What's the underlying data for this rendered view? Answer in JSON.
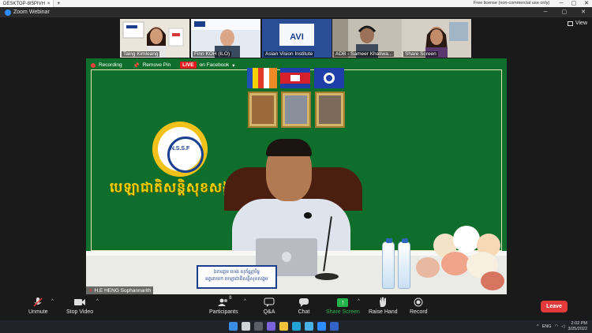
{
  "remote_bar": {
    "tab_title": "DESKTOP-8I5PIVH",
    "close": "×",
    "add": "+",
    "license": "Free license (non-commercial use only)",
    "controls": [
      "─",
      "▢",
      "✕"
    ]
  },
  "zoom_title": {
    "title": "Zoom Webinar",
    "controls": [
      "─",
      "▢",
      "✕"
    ]
  },
  "view_button": "View",
  "gallery": [
    {
      "name": "Taing Kimleang",
      "bg": "#e8e2d8",
      "person": "#5b3a2c"
    },
    {
      "name": "Finn KOH (ILO)",
      "bg": "#dfe6ef",
      "person": "#c89b7e"
    },
    {
      "name": "Asian Vision Institute",
      "bg": "#f2f4f8",
      "person": "#1b3f8a"
    },
    {
      "name": "ADB - Sameer Khatiwa...",
      "bg": "#c7c1b6",
      "person": "#8b6a58"
    },
    {
      "name": "Share Screen",
      "bg": "#d6cfc6",
      "person": "#6b4433"
    }
  ],
  "main_video": {
    "recording": "Recording",
    "remove_pin": "Remove Pin",
    "live": "LIVE",
    "on_facebook": "on Facebook",
    "org_logo_text": "N.S.S.F",
    "khmer_title": "បេឡាជាតិសន្តិសុខសង្គម",
    "nameplate_line1": "ឯកឧត្តម ហេង សុភ័ណ្ណារិទ្ធ",
    "nameplate_line2": "អគ្គនាយក បេឡាជាតិសន្តិសុខសង្គម",
    "speaker_name": "H.E HENG Sophannarith"
  },
  "toolbar": {
    "unmute": "Unmute",
    "stop_video": "Stop Video",
    "participants": "Participants",
    "participants_count": "8",
    "qa": "Q&A",
    "chat": "Chat",
    "share_screen": "Share Screen",
    "raise_hand": "Raise Hand",
    "record": "Record",
    "leave": "Leave"
  },
  "taskbar": {
    "lang": "ENG",
    "time": "2:02 PM",
    "date": "3/25/2022"
  },
  "colors": {
    "accent_green": "#25b34b",
    "leave_red": "#e03a3a",
    "live_red": "#e31b23",
    "video_green": "#0f6e2c"
  }
}
